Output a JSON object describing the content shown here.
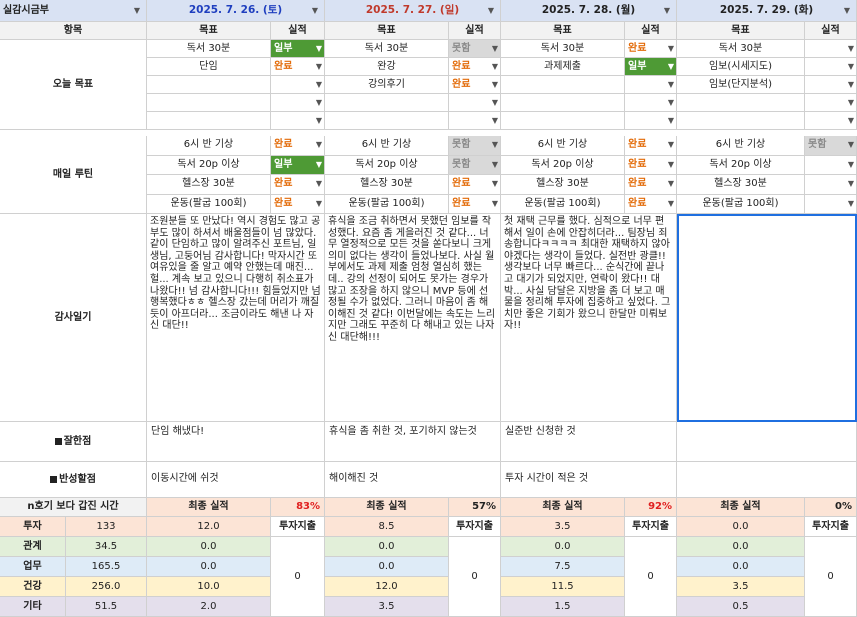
{
  "header": {
    "col_a_title": "실감시금부",
    "filter_icon": "filter-icon",
    "dates": [
      "2025. 7. 26. (토)",
      "2025. 7. 27. (일)",
      "2025. 7. 28. (월)",
      "2025. 7. 29. (화)"
    ],
    "date_colors": [
      "#1f3fbf",
      "#c0392b",
      "#222222",
      "#222222"
    ]
  },
  "subheader": {
    "item": "항목",
    "goal": "목표",
    "result": "실적"
  },
  "labels": {
    "today_goal": "오늘 목표",
    "daily_routine": "매일 루틴",
    "gratitude": "감사일기",
    "good": "잘한점",
    "reflect": "반성할점",
    "hours": "n호기 보다 갑진 시간"
  },
  "today_goals": [
    [
      {
        "g": "독서 30분",
        "s": "일부",
        "t": "part"
      },
      {
        "g": "독서 30분",
        "s": "못함",
        "t": "fail"
      },
      {
        "g": "독서 30분",
        "s": "완료",
        "t": "done"
      },
      {
        "g": "독서 30분",
        "s": "",
        "t": "empty"
      }
    ],
    [
      {
        "g": "단임",
        "s": "완료",
        "t": "done"
      },
      {
        "g": "완강",
        "s": "완료",
        "t": "done"
      },
      {
        "g": "과제제출",
        "s": "일부",
        "t": "part"
      },
      {
        "g": "임보(시세지도)",
        "s": "",
        "t": "empty"
      }
    ],
    [
      {
        "g": "",
        "s": "",
        "t": "empty"
      },
      {
        "g": "강의후기",
        "s": "완료",
        "t": "done"
      },
      {
        "g": "",
        "s": "",
        "t": "empty"
      },
      {
        "g": "임보(단지분석)",
        "s": "",
        "t": "empty"
      }
    ],
    [
      {
        "g": "",
        "s": "",
        "t": "empty"
      },
      {
        "g": "",
        "s": "",
        "t": "empty"
      },
      {
        "g": "",
        "s": "",
        "t": "empty"
      },
      {
        "g": "",
        "s": "",
        "t": "empty"
      }
    ],
    [
      {
        "g": "",
        "s": "",
        "t": "empty"
      },
      {
        "g": "",
        "s": "",
        "t": "empty"
      },
      {
        "g": "",
        "s": "",
        "t": "empty"
      },
      {
        "g": "",
        "s": "",
        "t": "empty"
      }
    ]
  ],
  "routines": [
    [
      {
        "g": "6시 반 기상",
        "s": "완료",
        "t": "done"
      },
      {
        "g": "6시 반 기상",
        "s": "못함",
        "t": "fail"
      },
      {
        "g": "6시 반 기상",
        "s": "완료",
        "t": "done"
      },
      {
        "g": "6시 반 기상",
        "s": "못함",
        "t": "fail"
      }
    ],
    [
      {
        "g": "독서 20p 이상",
        "s": "일부",
        "t": "part"
      },
      {
        "g": "독서 20p 이상",
        "s": "못함",
        "t": "fail"
      },
      {
        "g": "독서 20p 이상",
        "s": "완료",
        "t": "done"
      },
      {
        "g": "독서 20p 이상",
        "s": "",
        "t": "empty"
      }
    ],
    [
      {
        "g": "헬스장 30분",
        "s": "완료",
        "t": "done"
      },
      {
        "g": "헬스장 30분",
        "s": "완료",
        "t": "done"
      },
      {
        "g": "헬스장 30분",
        "s": "완료",
        "t": "done"
      },
      {
        "g": "헬스장 30분",
        "s": "",
        "t": "empty"
      }
    ],
    [
      {
        "g": "운동(팔굽 100회)",
        "s": "완료",
        "t": "done"
      },
      {
        "g": "운동(팔굽 100회)",
        "s": "완료",
        "t": "done"
      },
      {
        "g": "운동(팔굽 100회)",
        "s": "완료",
        "t": "done"
      },
      {
        "g": "운동(팔굽 100회)",
        "s": "",
        "t": "empty"
      }
    ]
  ],
  "diary": [
    "조원분들 또 만났다! 역시 경험도 많고 공부도 많이 하셔서 배울점들이 넘 많았다. 같이 단임하고 많이 알려주신 포트님, 일생님, 고둥어님 감사합니다! 막자시간 또 여유있을 줄 알고 예약 안했는데 매진... 헐... 계속 보고 있으니 다행히 취소표가 나왔다!! 넘 감사합니다!!! 힘들었지만 넘 행복했다ㅎㅎ 헬스장 갔는데 머리가 깨질듯이 아프더라... 조금이라도 해낸 나 자신 대단!!",
    "휴식을 조금 취하면서 못했던 임보를 작성했다. 요즘 좀 게을러진 것 같다... 너무 열정적으로 모든 것을 쏟다보니 크게 의미 없다는 생각이 들었나보다. 사실 월부에서도 과제 제출 엄청 열심히 했는데.. 강의 선정이 되어도 못가는 경우가 많고 조장을 하지 않으니 MVP 등에 선정될 수가 없었다. 그러니 마음이 좀 해이해진 것 같다! 이번달에는 속도는 느리지만 그래도 꾸준히 다 해내고 있는 나자신 대단해!!!",
    "첫 재택 근무를 했다. 심적으로 너무 편해서 일이 손에 안잡히더라... 팀장님 죄송합니다ㅋㅋㅋㅋ 최대한 재택하지 않아야겠다는 생각이 들었다. 실전반 광클!! 생각보다 너무 빠르다... 순식간에 끝나고 대기가 되었지만, 연락이 왔다!! 대박... 사실 담달은 지방을 좀 더 보고 매물을 정리해 투자에 집중하고 싶었다. 그치만 좋은 기회가 왔으니 한달만 미뤄보자!!",
    ""
  ],
  "good": [
    "단임 해냈다!",
    "휴식을 좀 취한 것, 포기하지 않는것",
    "실준반 신청한 것",
    ""
  ],
  "reflect": [
    "이동시간에 쉬것",
    "해이해진 것",
    "투자 시간이 적은 것",
    ""
  ],
  "final": {
    "label": "최종 실적",
    "pcts": [
      "83%",
      "57%",
      "92%",
      "0%"
    ],
    "pct_red": [
      true,
      false,
      true,
      false
    ]
  },
  "categories": [
    {
      "name": "투자",
      "total": "133",
      "vals": [
        "12.0",
        "8.5",
        "3.5",
        "0.0"
      ]
    },
    {
      "name": "관계",
      "total": "34.5",
      "vals": [
        "0.0",
        "0.0",
        "0.0",
        "0.0"
      ]
    },
    {
      "name": "업무",
      "total": "165.5",
      "vals": [
        "0.0",
        "0.0",
        "7.5",
        "0.0"
      ]
    },
    {
      "name": "건강",
      "total": "256.0",
      "vals": [
        "10.0",
        "12.0",
        "11.5",
        "3.5"
      ]
    },
    {
      "name": "기타",
      "total": "51.5",
      "vals": [
        "2.0",
        "3.5",
        "1.5",
        "0.5"
      ]
    }
  ],
  "invest_spend": {
    "label": "투자지출",
    "values": [
      "0",
      "0",
      "0",
      "0"
    ]
  },
  "colors": {
    "header_bg": "#d9e2f3",
    "partial_green": "#4e9a35",
    "done_orange": "#e36c0a",
    "fail_gray": "#d9d9d9",
    "selection_blue": "#1f6fe0"
  }
}
